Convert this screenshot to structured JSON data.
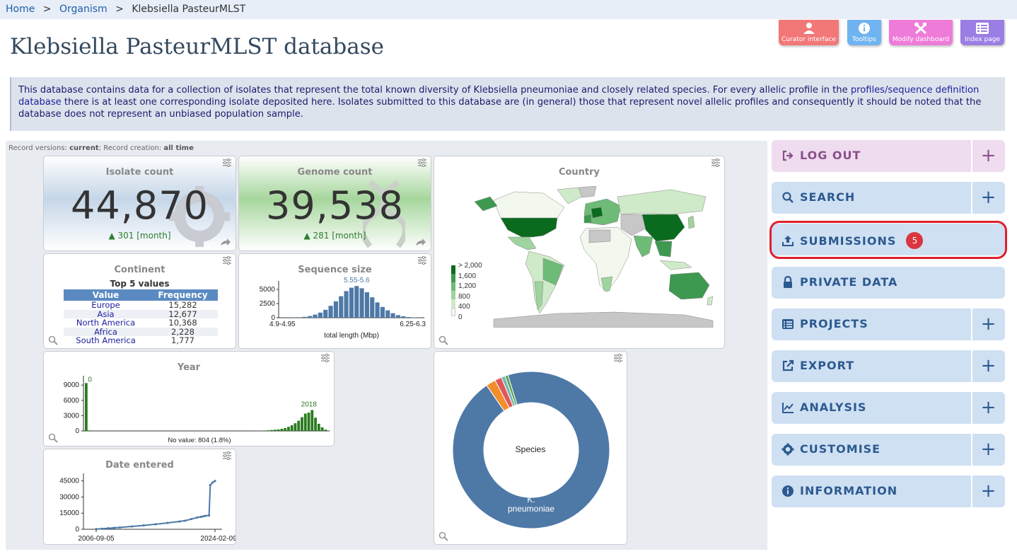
{
  "breadcrumb": {
    "home": "Home",
    "organism": "Organism",
    "current": "Klebsiella PasteurMLST",
    "sep": ">"
  },
  "page_title": "Klebsiella PasteurMLST database",
  "top_buttons": [
    {
      "label": "Curator interface",
      "color": "#f27878",
      "icon": "person-icon"
    },
    {
      "label": "Tooltips",
      "color": "#6fb4f0",
      "icon": "info-icon"
    },
    {
      "label": "Modify dashboard",
      "color": "#ef7bd9",
      "icon": "tools-icon"
    },
    {
      "label": "Index page",
      "color": "#9b7ee3",
      "icon": "list-icon"
    }
  ],
  "intro": {
    "text_before": "This database contains data for a collection of isolates that represent the total known diversity of Klebsiella pneumoniae and closely related species. For every allelic profile in the ",
    "link": "profiles/sequence definition database",
    "text_after": " there is at least one corresponding isolate deposited here. Isolates submitted to this database are (in general) those that represent novel allelic profiles and consequently it should be noted that the database does not represent an unbiased population sample."
  },
  "dashboard": {
    "meta": {
      "versions_label": "Record versions: ",
      "versions_value": "current",
      "creation_label": "; Record creation: ",
      "creation_value": "all time"
    },
    "isolate_count": {
      "title": "Isolate count",
      "value": "44,870",
      "delta": "301 [month]"
    },
    "genome_count": {
      "title": "Genome count",
      "value": "39,538",
      "delta": "281 [month]"
    },
    "country": {
      "title": "Country",
      "legend": [
        {
          "label": "> 2,000",
          "color": "#0a6b1e"
        },
        {
          "label": "1,600",
          "color": "#3d9950"
        },
        {
          "label": "1,200",
          "color": "#6dbb77"
        },
        {
          "label": "800",
          "color": "#9fd39f"
        },
        {
          "label": "400",
          "color": "#cfeac9"
        },
        {
          "label": "0",
          "color": "#f2f8ee"
        }
      ]
    },
    "continent": {
      "title": "Continent",
      "subtitle": "Top 5 values",
      "headers": [
        "Value",
        "Frequency"
      ],
      "rows": [
        {
          "value": "Europe",
          "freq": "15,282"
        },
        {
          "value": "Asia",
          "freq": "12,677"
        },
        {
          "value": "North America",
          "freq": "10,368"
        },
        {
          "value": "Africa",
          "freq": "2,228"
        },
        {
          "value": "South America",
          "freq": "1,777"
        }
      ]
    },
    "species": {
      "center_label": "Species",
      "slice_label": "K. pneumoniae"
    }
  },
  "chart_data": [
    {
      "type": "bar",
      "title": "Sequence size",
      "xlabel": "total length (Mbp)",
      "x_tick_labels": [
        "4.9-4.95",
        "6.25-6.3"
      ],
      "highlight_label": "5.55-5.6",
      "y_ticks": [
        0,
        2500,
        5000
      ],
      "ylim": [
        0,
        6000
      ],
      "values": [
        10,
        20,
        40,
        80,
        150,
        300,
        550,
        900,
        1400,
        2100,
        2900,
        3800,
        4700,
        5300,
        5600,
        5200,
        4500,
        3600,
        2700,
        1900,
        1300,
        800,
        450,
        250,
        120,
        60,
        30
      ]
    },
    {
      "type": "bar",
      "title": "Year",
      "annotation": "No value: 804 (1.8%)",
      "peak_labels": [
        "0",
        "2018"
      ],
      "y_ticks": [
        0,
        3000,
        6000,
        9000
      ],
      "ylim": [
        0,
        10000
      ],
      "color": "#2a7a1f",
      "values": [
        9400,
        100,
        0,
        0,
        0,
        0,
        0,
        0,
        0,
        0,
        0,
        0,
        0,
        0,
        0,
        0,
        0,
        0,
        0,
        0,
        0,
        0,
        0,
        0,
        0,
        0,
        0,
        0,
        0,
        0,
        0,
        0,
        0,
        0,
        0,
        0,
        0,
        0,
        0,
        0,
        0,
        0,
        0,
        0,
        0,
        0,
        0,
        0,
        0,
        0,
        20,
        30,
        50,
        80,
        120,
        180,
        250,
        300,
        420,
        550,
        800,
        1100,
        1500,
        2000,
        2700,
        3400,
        3600,
        4100,
        2600,
        1400,
        700,
        250,
        50
      ]
    },
    {
      "type": "line",
      "title": "Date entered",
      "x_tick_labels": [
        "2006-09-05",
        "2024-02-09"
      ],
      "y_ticks": [
        0,
        15000,
        30000,
        45000
      ],
      "ylim": [
        0,
        48000
      ],
      "x": [
        0,
        0.05,
        0.1,
        0.15,
        0.2,
        0.3,
        0.4,
        0.5,
        0.6,
        0.7,
        0.75,
        0.8,
        0.85,
        0.88,
        0.9,
        0.92,
        0.95,
        0.96,
        0.98,
        1.0
      ],
      "values": [
        200,
        500,
        900,
        1300,
        1700,
        2600,
        3600,
        4700,
        5900,
        7200,
        8000,
        9500,
        11000,
        11500,
        12000,
        12500,
        12800,
        41000,
        43500,
        44870
      ]
    },
    {
      "type": "pie",
      "title": "Species",
      "colors": [
        "#4e79a7",
        "#f28e2b",
        "#e15759",
        "#76b7b2",
        "#59a14f"
      ],
      "labels": [
        "K. pneumoniae"
      ],
      "values": [
        95.2,
        2.0,
        1.4,
        0.8,
        0.6
      ]
    }
  ],
  "nav": [
    {
      "label": "LOG OUT",
      "icon": "logout-icon",
      "plus": true,
      "style": "logout"
    },
    {
      "label": "SEARCH",
      "icon": "search-icon",
      "plus": true
    },
    {
      "label": "SUBMISSIONS",
      "icon": "upload-icon",
      "plus": false,
      "badge": "5"
    },
    {
      "label": "PRIVATE DATA",
      "icon": "lock-icon",
      "plus": false
    },
    {
      "label": "PROJECTS",
      "icon": "list-icon",
      "plus": true
    },
    {
      "label": "EXPORT",
      "icon": "external-link-icon",
      "plus": true
    },
    {
      "label": "ANALYSIS",
      "icon": "chart-icon",
      "plus": true
    },
    {
      "label": "CUSTOMISE",
      "icon": "cog-icon",
      "plus": true
    },
    {
      "label": "INFORMATION",
      "icon": "info-circle-icon",
      "plus": true
    }
  ],
  "plus_symbol": "+"
}
